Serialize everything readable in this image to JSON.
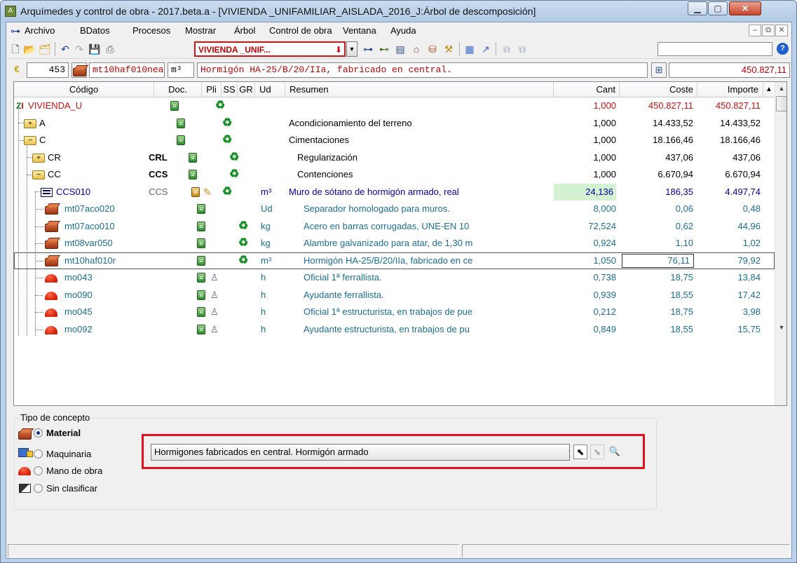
{
  "window": {
    "title": "Arquímedes y control de obra - 2017.beta.a - [VIVIENDA _UNIFAMILIAR_AISLADA_2016_J:Árbol de descomposición]"
  },
  "menu": {
    "items": [
      "Archivo",
      "BDatos",
      "Procesos",
      "Mostrar",
      "Árbol",
      "Control de obra",
      "Ventana",
      "Ayuda"
    ]
  },
  "toolbar": {
    "project_combo": "VIVIENDA _UNIF...",
    "search_value": ""
  },
  "infobar": {
    "number": "453",
    "code": "mt10haf010nea",
    "unit": "m³",
    "summary": "Hormigón HA-25/B/20/IIa, fabricado en central.",
    "amount": "450.827,11"
  },
  "grid": {
    "headers": {
      "codigo": "Código",
      "doc": "Doc.",
      "pli": "Pli",
      "ss": "SS",
      "gr": "GR",
      "ud": "Ud",
      "resumen": "Resumen",
      "cant": "Cant",
      "coste": "Coste",
      "importe": "Importe"
    },
    "rows": [
      {
        "code": "VIVIENDA_U",
        "doc": "",
        "ud": "",
        "resumen": "",
        "cant": "1,000",
        "coste": "450.827,11",
        "importe": "450.827,11"
      },
      {
        "code": "A",
        "doc": "",
        "ud": "",
        "resumen": "Acondicionamiento del terreno",
        "cant": "1,000",
        "coste": "14.433,52",
        "importe": "14.433,52"
      },
      {
        "code": "C",
        "doc": "",
        "ud": "",
        "resumen": "Cimentaciones",
        "cant": "1,000",
        "coste": "18.166,46",
        "importe": "18.166,46"
      },
      {
        "code": "CR",
        "doc": "CRL",
        "ud": "",
        "resumen": "Regularización",
        "cant": "1,000",
        "coste": "437,06",
        "importe": "437,06"
      },
      {
        "code": "CC",
        "doc": "CCS",
        "ud": "",
        "resumen": "Contenciones",
        "cant": "1,000",
        "coste": "6.670,94",
        "importe": "6.670,94"
      },
      {
        "code": "CCS010",
        "doc": "CCS",
        "ud": "m³",
        "resumen": "Muro de sótano de hormigón armado, real",
        "cant": "24,136",
        "coste": "186,35",
        "importe": "4.497,74"
      },
      {
        "code": "mt07aco020",
        "doc": "",
        "ud": "Ud",
        "resumen": "Separador homologado para muros.",
        "cant": "8,000",
        "coste": "0,06",
        "importe": "0,48"
      },
      {
        "code": "mt07aco010",
        "doc": "",
        "ud": "kg",
        "resumen": "Acero en barras corrugadas, UNE-EN 10",
        "cant": "72,524",
        "coste": "0,62",
        "importe": "44,96"
      },
      {
        "code": "mt08var050",
        "doc": "",
        "ud": "kg",
        "resumen": "Alambre galvanizado para atar, de 1,30 m",
        "cant": "0,924",
        "coste": "1,10",
        "importe": "1,02"
      },
      {
        "code": "mt10haf010r",
        "doc": "",
        "ud": "m³",
        "resumen": "Hormigón HA-25/B/20/IIa, fabricado en ce",
        "cant": "1,050",
        "coste": "76,11",
        "importe": "79,92"
      },
      {
        "code": "mo043",
        "doc": "",
        "ud": "h",
        "resumen": "Oficial 1ª ferrallista.",
        "cant": "0,738",
        "coste": "18,75",
        "importe": "13,84"
      },
      {
        "code": "mo090",
        "doc": "",
        "ud": "h",
        "resumen": "Ayudante ferrallista.",
        "cant": "0,939",
        "coste": "18,55",
        "importe": "17,42"
      },
      {
        "code": "mo045",
        "doc": "",
        "ud": "h",
        "resumen": "Oficial 1ª estructurista, en trabajos de pue",
        "cant": "0,212",
        "coste": "18,75",
        "importe": "3,98"
      },
      {
        "code": "mo092",
        "doc": "",
        "ud": "h",
        "resumen": "Ayudante estructurista, en trabajos de pu",
        "cant": "0,849",
        "coste": "18,55",
        "importe": "15,75"
      }
    ]
  },
  "concept_type": {
    "title": "Tipo de concepto",
    "options": [
      "Material",
      "Maquinaria",
      "Mano de obra",
      "Sin clasificar"
    ],
    "selected": "Material",
    "category_value": "Hormigones fabricados en central. Hormigón armado"
  },
  "colors": {
    "code_red": "#d01010",
    "highlight_red": "#e01020",
    "cant_highlight": "#d3f2d1"
  }
}
